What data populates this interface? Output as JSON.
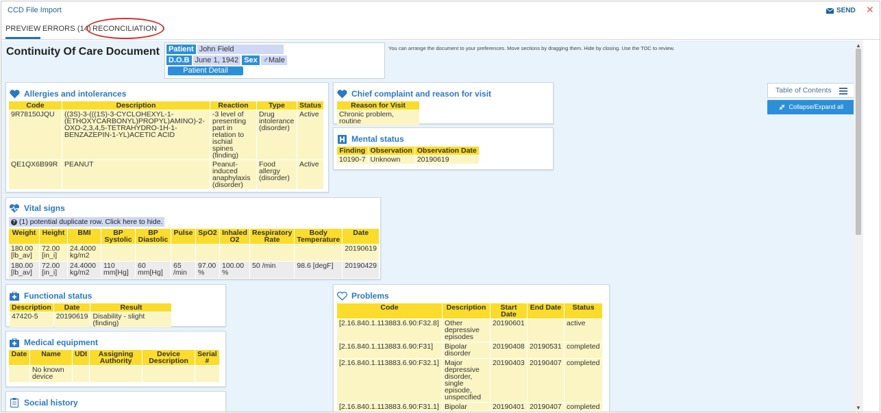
{
  "window": {
    "title": "CCD File Import",
    "send_label": "SEND",
    "close_label": "✕"
  },
  "tabs": {
    "preview": "PREVIEW",
    "errors": "ERRORS (14)",
    "reconciliation": "RECONCILIATION"
  },
  "doc": {
    "title": "Continuity Of Care Document",
    "hint": "You can arrange the document to your preferences. Move sections by dragging them. Hide by closing. Use the TOC to review."
  },
  "patient": {
    "patient_label": "Patient",
    "name": "John Field",
    "dob_label": "D.O.B",
    "dob": "June 1, 1942",
    "sex_label": "Sex",
    "sex": "♂Male",
    "detail_button": "Patient Detail"
  },
  "toc": {
    "label": "Table of Contents",
    "collapse_label": "Collapse/Expand all"
  },
  "allergies": {
    "title": "Allergies and intolerances",
    "headers": [
      "Code",
      "Description",
      "Reaction",
      "Type",
      "Status"
    ],
    "rows": [
      {
        "code": "9R78150JQU",
        "description": "((3S)-3-(((1S)-3-CYCLOHEXYL-1-(ETHOXYCARBONYL)PROPYL)AMINO)-2-OXO-2,3,4,5-TETRAHYDRO-1H-1-BENZAZEPIN-1-YL)ACETIC ACID",
        "reaction": "-3 level of presenting part in relation to ischial spines (finding)",
        "type": "Drug intolerance (disorder)",
        "status": "Active"
      },
      {
        "code": "QE1QX6B99R",
        "description": "PEANUT",
        "reaction": "Peanut-induced anaphylaxis (disorder)",
        "type": "Food allergy (disorder)",
        "status": "Active"
      }
    ]
  },
  "chief": {
    "title": "Chief complaint and reason for visit",
    "header": "Reason for Visit",
    "value": "Chronic problem, routine"
  },
  "mental": {
    "title": "Mental status",
    "headers": [
      "Finding",
      "Observation",
      "Observation Date"
    ],
    "row": {
      "finding": "10190-7",
      "observation": "Unknown",
      "date": "20190619"
    }
  },
  "vitals": {
    "title": "Vital signs",
    "dup_note": "(1) potential duplicate row. Click here to hide.",
    "headers": [
      "Weight",
      "Height",
      "BMI",
      "BP Systolic",
      "BP Diastolic",
      "Pulse",
      "SpO2",
      "Inhaled O2",
      "Respiratory Rate",
      "Body Temperature",
      "Date"
    ],
    "rows": [
      [
        "180.00 [lb_av]",
        "72.00 [in_i]",
        "24.4000 kg/m2",
        "",
        "",
        "",
        "",
        "",
        "",
        "",
        "20190619"
      ],
      [
        "180.00 [lb_av]",
        "72.00 [in_i]",
        "24.4000 kg/m2",
        "110 mm[Hg]",
        "60 mm[Hg]",
        "65 /min",
        "97.00 %",
        "100.00 %",
        "50 /min",
        "98.6 [degF]",
        "20190429"
      ]
    ]
  },
  "functional": {
    "title": "Functional status",
    "headers": [
      "Description",
      "Date",
      "Result"
    ],
    "row": {
      "description": "47420-5",
      "date": "20190619",
      "result": "Disability - slight (finding)"
    }
  },
  "equipment": {
    "title": "Medical equipment",
    "headers": [
      "Date",
      "Name",
      "UDI",
      "Assigning Authority",
      "Device Description",
      "Serial #"
    ],
    "row": {
      "date": "",
      "name": "No known device",
      "udi": "",
      "authority": "",
      "device": "",
      "serial": ""
    }
  },
  "social": {
    "title": "Social history"
  },
  "problems": {
    "title": "Problems",
    "headers": [
      "Code",
      "Description",
      "Start Date",
      "End Date",
      "Status"
    ],
    "rows": [
      {
        "code": "[2.16.840.1.113883.6.90:F32.8]",
        "description": "Other depressive episodes",
        "start": "20190601",
        "end": "",
        "status": "active"
      },
      {
        "code": "[2.16.840.1.113883.6.90:F31]",
        "description": "Bipolar disorder",
        "start": "20190408",
        "end": "20190531",
        "status": "completed"
      },
      {
        "code": "[2.16.840.1.113883.6.90:F32.1]",
        "description": "Major depressive disorder, single episode, unspecified",
        "start": "20190403",
        "end": "20190407",
        "status": "completed"
      },
      {
        "code": "[2.16.840.1.113883.6.90:F31.1]",
        "description": "Bipolar",
        "start": "20190401",
        "end": "20190407",
        "status": "completed"
      }
    ]
  },
  "colors": {
    "accent": "#2b79c2",
    "header_yellow": "#fbdc2c",
    "cell_yellow": "#fbf5c4",
    "button_blue": "#2d8fd8",
    "highlight_red": "#d43030"
  }
}
